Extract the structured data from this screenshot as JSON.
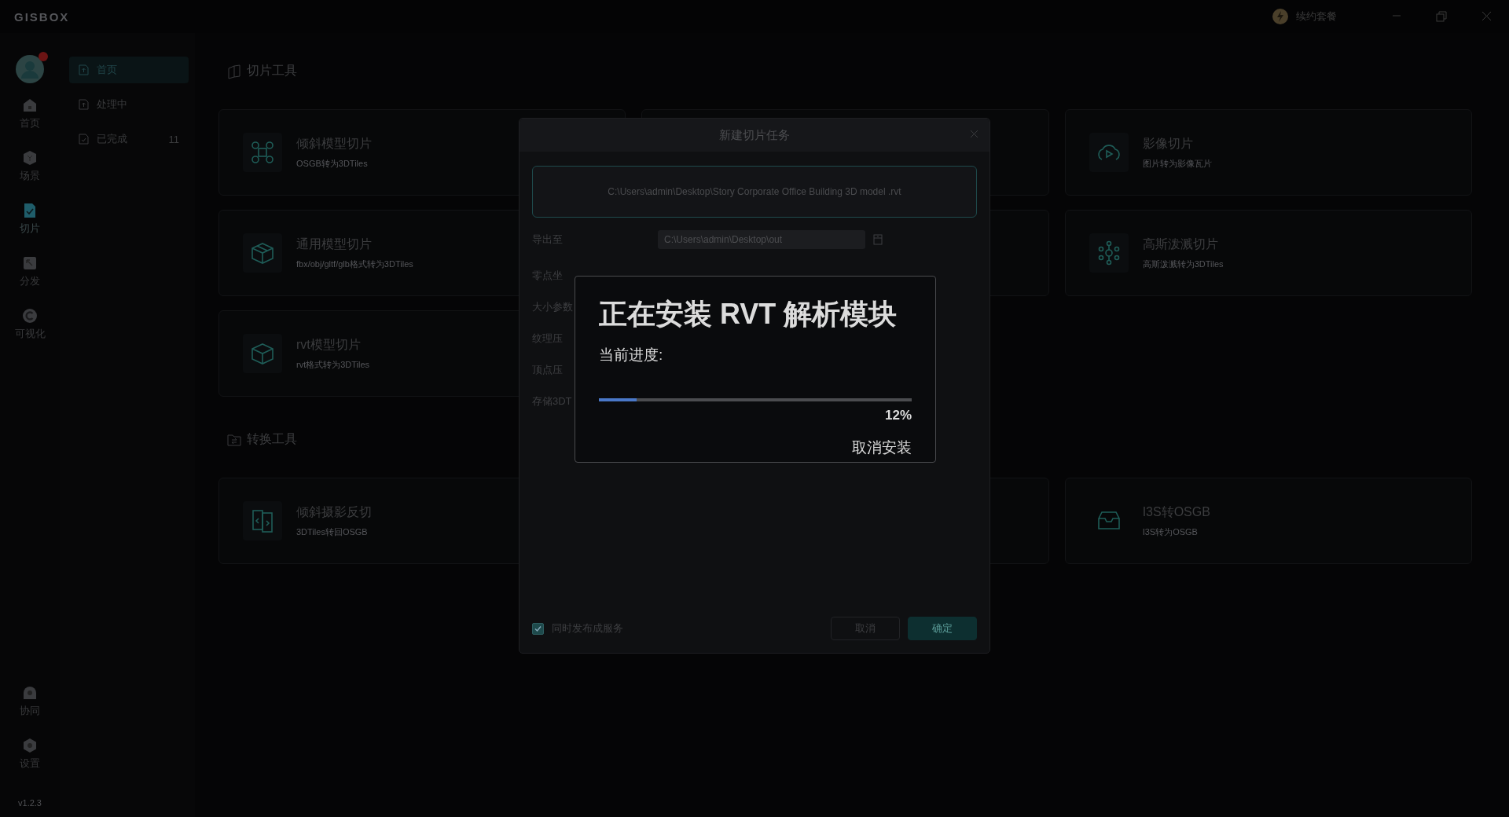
{
  "titlebar": {
    "logo": "GISBOX",
    "renew": "续约套餐"
  },
  "rail": {
    "items": [
      {
        "label": "首页",
        "selected": false
      },
      {
        "label": "场景",
        "selected": false
      },
      {
        "label": "切片",
        "selected": true
      },
      {
        "label": "分发",
        "selected": false
      },
      {
        "label": "可视化",
        "selected": false
      }
    ],
    "bottom_items": [
      {
        "label": "协同",
        "selected": false
      },
      {
        "label": "设置",
        "selected": false
      }
    ],
    "version": "v1.2.3"
  },
  "nav": {
    "items": [
      {
        "label": "首页",
        "selected": true
      },
      {
        "label": "处理中",
        "selected": false
      },
      {
        "label": "已完成",
        "selected": false,
        "count": "11"
      }
    ]
  },
  "sections": [
    {
      "title": "切片工具",
      "cards": [
        {
          "kind": "tool",
          "title": "倾斜模型切片",
          "subtitle": "OSGB转为3DTiles"
        },
        {
          "kind": "covered"
        },
        {
          "kind": "tool",
          "title": "影像切片",
          "subtitle": "图片转为影像瓦片"
        },
        {
          "kind": "tool",
          "title": "通用模型切片",
          "subtitle": "fbx/obj/gltf/glb格式转为3DTiles"
        },
        {
          "kind": "covered"
        },
        {
          "kind": "tool",
          "title": "高斯泼溅切片",
          "subtitle": "高斯泼溅转为3DTiles"
        },
        {
          "kind": "tool",
          "title": "rvt模型切片",
          "subtitle": "rvt格式转为3DTiles"
        }
      ]
    },
    {
      "title": "转换工具",
      "cards": [
        {
          "kind": "tool",
          "title": "倾斜摄影反切",
          "subtitle": "3DTiles转回OSGB"
        },
        {
          "kind": "covered"
        },
        {
          "kind": "tool",
          "title": "I3S转OSGB",
          "subtitle": "I3S转为OSGB"
        }
      ]
    }
  ],
  "dialog": {
    "title": "新建切片任务",
    "file_path": "C:\\Users\\admin\\Desktop\\Story Corporate Office Building 3D model .rvt",
    "export": {
      "label": "导出至",
      "value": "C:\\Users\\admin\\Desktop\\out"
    },
    "covered_labels": [
      "零点坐",
      "大小参数",
      "纹理压",
      "顶点压",
      "存储3DT"
    ],
    "publish": {
      "label": "同时发布成服务",
      "checked": true
    },
    "buttons": [
      {
        "label": "取消",
        "kind": "secondary"
      },
      {
        "label": "确定",
        "kind": "primary"
      }
    ]
  },
  "install": {
    "title": "正在安装 RVT 解析模块",
    "progress_label": "当前进度:",
    "level": 0.12,
    "reading": "12%",
    "cancel": "取消安装"
  }
}
